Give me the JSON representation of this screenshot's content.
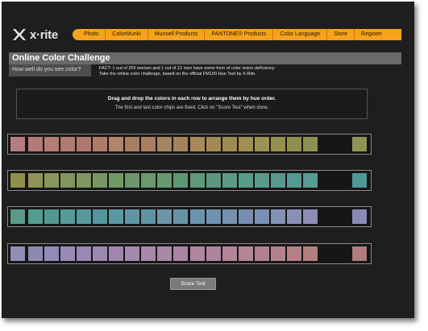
{
  "brand": {
    "logo_text": "x·rite"
  },
  "nav": {
    "items": [
      "Photo",
      "ColorMunki",
      "Munsell Products",
      "PANTONE® Products",
      "Color Language",
      "Store",
      "Register"
    ]
  },
  "header": {
    "title": "Online Color Challenge",
    "subtitle": "How well do you see color?",
    "fact_line_1": "FACT: 1 out of 255 women and 1 out of 12 men have some form of color vision deficiency.",
    "fact_line_2": "Take the online color challenge, based on the official FM100 Hue Test by X-Rite."
  },
  "instructions": {
    "line_1": "Drag and drop the colors in each row to arrange them by hue order.",
    "line_2": "The first and last color chips are fixed.  Click on \"Score Test\" when done."
  },
  "colors": {
    "accent": "#f5a21c",
    "background": "#1e1e1e"
  },
  "rows": [
    {
      "chips": [
        "#b67c7e",
        "#b27b76",
        "#b57d74",
        "#b07b70",
        "#b1796f",
        "#af7c6a",
        "#b2846a",
        "#a97d62",
        "#aa7f5f",
        "#a6865e",
        "#a4845a",
        "#a88a58",
        "#a38a55",
        "#9d8c52",
        "#a18f50",
        "#9b9351",
        "#95914d",
        "#8f914d",
        "#8b9250",
        "#8f9555"
      ]
    },
    {
      "chips": [
        "#8f8f50",
        "#8f9356",
        "#88975c",
        "#83955e",
        "#7c9760",
        "#789863",
        "#729866",
        "#6c976a",
        "#699a6e",
        "#65996f",
        "#5e9871",
        "#5d9a78",
        "#5b977d",
        "#5c9a83",
        "#589b8a",
        "#5a9a8a",
        "#57998c",
        "#549a92",
        "#579a96",
        "#509895"
      ]
    },
    {
      "chips": [
        "#5a9a88",
        "#559b8e",
        "#4f9993",
        "#539c97",
        "#55999a",
        "#55969e",
        "#5a98a3",
        "#5f96a6",
        "#5d94a7",
        "#6a97a7",
        "#6695aa",
        "#6a94ad",
        "#6e92b0",
        "#7691ad",
        "#778eb1",
        "#7c8fb4",
        "#8392b3",
        "#8890b4",
        "#8b8db3",
        "#888ab5"
      ]
    },
    {
      "chips": [
        "#8f8fb6",
        "#8d8ab2",
        "#928bb7",
        "#998ab6",
        "#9987b4",
        "#9b88ae",
        "#a086ae",
        "#a489ae",
        "#a888ab",
        "#ab88a6",
        "#ab84a2",
        "#b186a1",
        "#af849e",
        "#b38599",
        "#b38695",
        "#b3808f",
        "#b3818b",
        "#b57f84",
        "#b37e80",
        "#b17c7b"
      ]
    }
  ],
  "actions": {
    "score_label": "Score Test"
  }
}
